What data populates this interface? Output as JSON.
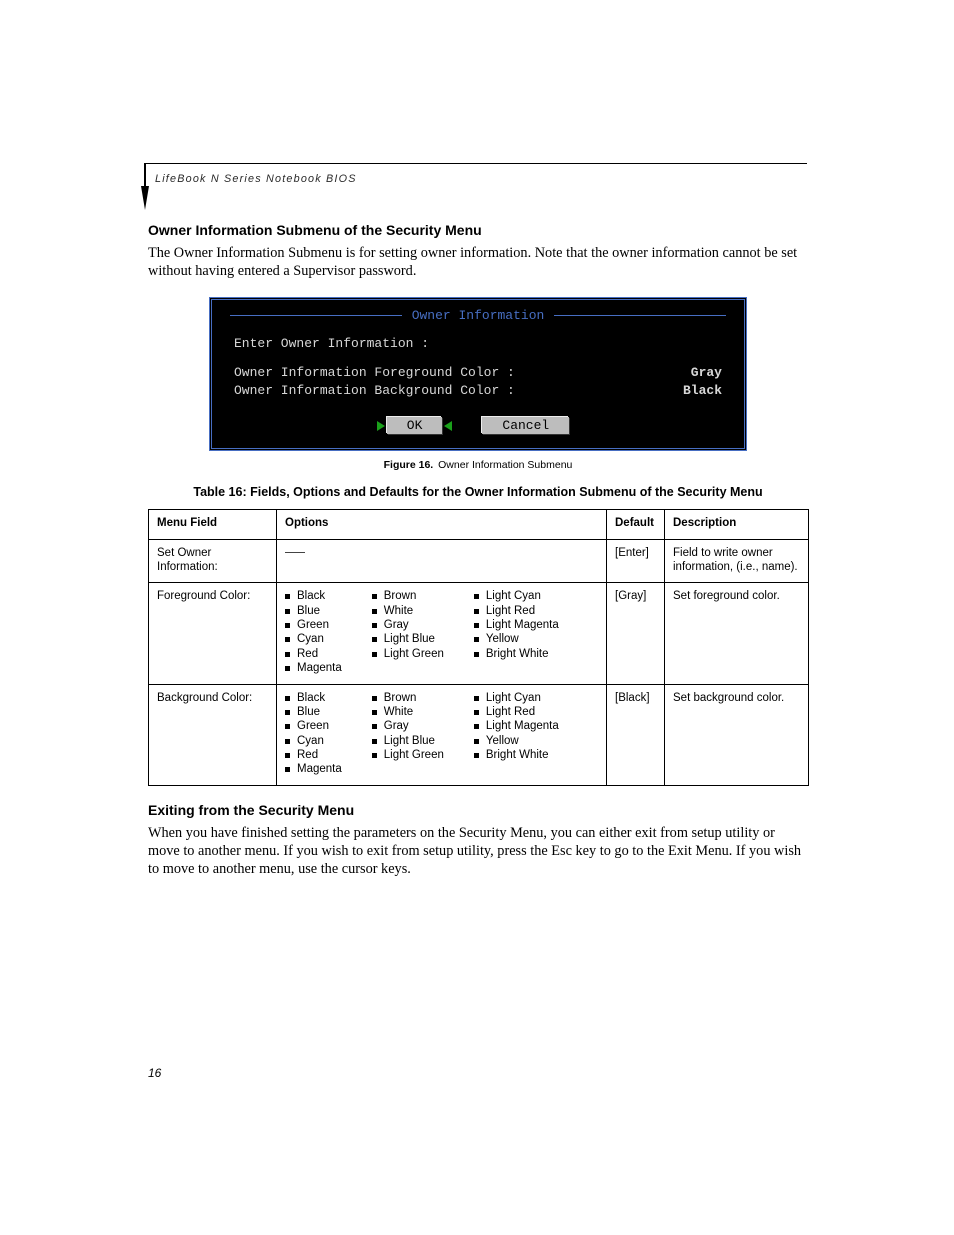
{
  "running_head": "LifeBook N Series Notebook BIOS",
  "section1": {
    "heading": "Owner Information Submenu of the Security Menu",
    "para": "The Owner Information Submenu is for setting owner information. Note that the owner information cannot be set without having entered a Supervisor password."
  },
  "bios": {
    "title": "Owner Information",
    "enter_label": "Enter Owner Information :",
    "fg_label": "Owner Information Foreground Color :",
    "bg_label": "Owner Information Background Color :",
    "fg_value": "Gray",
    "bg_value": "Black",
    "ok": "OK",
    "cancel": "Cancel"
  },
  "figure_caption_label": "Figure 16.",
  "figure_caption_text": "Owner Information Submenu",
  "table_caption": "Table 16: Fields, Options and Defaults for the Owner Information Submenu of the Security Menu",
  "table": {
    "headers": {
      "c1": "Menu Field",
      "c2": "Options",
      "c3": "Default",
      "c4": "Description"
    },
    "rows": [
      {
        "field": "Set Owner Information:",
        "options": null,
        "default": "[Enter]",
        "desc": "Field to write owner information, (i.e., name)."
      },
      {
        "field": "Foreground Color:",
        "options": {
          "col1": [
            "Black",
            "Blue",
            "Green",
            "Cyan",
            "Red",
            "Magenta"
          ],
          "col2": [
            "Brown",
            "White",
            "Gray",
            "Light Blue",
            "Light Green"
          ],
          "col3": [
            "Light Cyan",
            "Light Red",
            "Light Magenta",
            "Yellow",
            "Bright White"
          ]
        },
        "default": "[Gray]",
        "desc": "Set foreground color."
      },
      {
        "field": "Background Color:",
        "options": {
          "col1": [
            "Black",
            "Blue",
            "Green",
            "Cyan",
            "Red",
            "Magenta"
          ],
          "col2": [
            "Brown",
            "White",
            "Gray",
            "Light Blue",
            "Light Green"
          ],
          "col3": [
            "Light Cyan",
            "Light Red",
            "Light Magenta",
            "Yellow",
            "Bright White"
          ]
        },
        "default": "[Black]",
        "desc": "Set background color."
      }
    ]
  },
  "section2": {
    "heading": "Exiting from the Security Menu",
    "para": "When you have finished setting the parameters on the Security Menu, you can either exit from setup utility or move to another menu. If you wish to exit from setup utility, press the Esc key to go to the Exit Menu. If you wish to move to another menu, use the cursor keys."
  },
  "page_number": "16"
}
